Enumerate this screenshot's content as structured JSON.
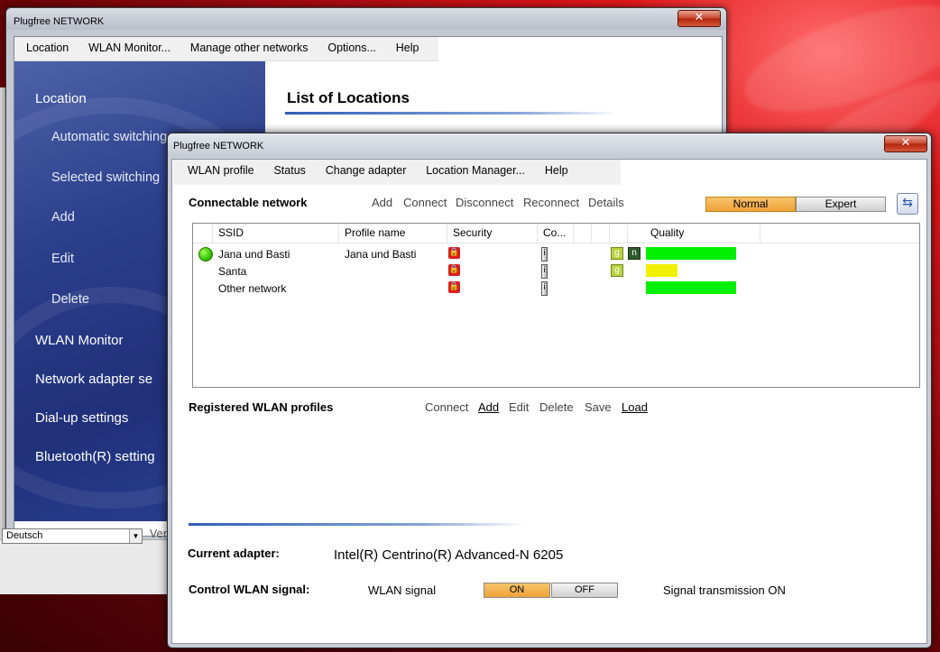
{
  "back_window": {
    "title": "Plugfree NETWORK",
    "close_label": "✕",
    "menu": [
      "Location",
      "WLAN Monitor...",
      "Manage other networks",
      "Options...",
      "Help"
    ],
    "sidebar": {
      "items": [
        "Location",
        "Automatic switching",
        "Selected switching",
        "Add",
        "Edit",
        "Delete",
        "WLAN Monitor",
        "Network adapter se",
        "Dial-up settings",
        "Bluetooth(R) setting"
      ]
    },
    "heading": "List of Locations",
    "language": "Deutsch",
    "version_label": "Ver"
  },
  "front_window": {
    "title": "Plugfree NETWORK",
    "close_label": "✕",
    "menu": [
      "WLAN profile",
      "Status",
      "Change adapter",
      "Location Manager...",
      "Help"
    ],
    "connectable": {
      "title": "Connectable network",
      "actions": [
        "Add",
        "Connect",
        "Disconnect",
        "Reconnect",
        "Details"
      ],
      "mode_normal": "Normal",
      "mode_expert": "Expert",
      "active_mode": "Normal",
      "refresh_icon": "refresh-icon"
    },
    "table": {
      "columns": [
        "SSID",
        "Profile name",
        "Security",
        "Co...",
        "Quality"
      ],
      "rows": [
        {
          "ssid": "Jana und Basti",
          "profile": "Jana und Basti",
          "connected": true,
          "secured": true,
          "bands": [
            "g",
            "n"
          ],
          "quality": 1.0,
          "quality_color": "#00f000"
        },
        {
          "ssid": "Santa",
          "profile": "",
          "connected": false,
          "secured": true,
          "bands": [
            "g"
          ],
          "quality": 0.35,
          "quality_color": "#f0f000"
        },
        {
          "ssid": "Other network",
          "profile": "",
          "connected": false,
          "secured": true,
          "bands": [],
          "quality": 1.0,
          "quality_color": "#00f000"
        }
      ]
    },
    "registered": {
      "title": "Registered WLAN profiles",
      "actions": [
        "Connect",
        "Add",
        "Edit",
        "Delete",
        "Save",
        "Load"
      ]
    },
    "adapter": {
      "label": "Current adapter:",
      "value": "Intel(R) Centrino(R) Advanced-N 6205"
    },
    "signal": {
      "label": "Control WLAN signal:",
      "wlan_label": "WLAN signal",
      "on_label": "ON",
      "off_label": "OFF",
      "state": "ON",
      "status": "Signal transmission ON"
    }
  },
  "colors": {
    "accent_orange": "#eea23a",
    "sidebar_blue": "#2c3f8c",
    "lock_red": "#d81e1e"
  }
}
